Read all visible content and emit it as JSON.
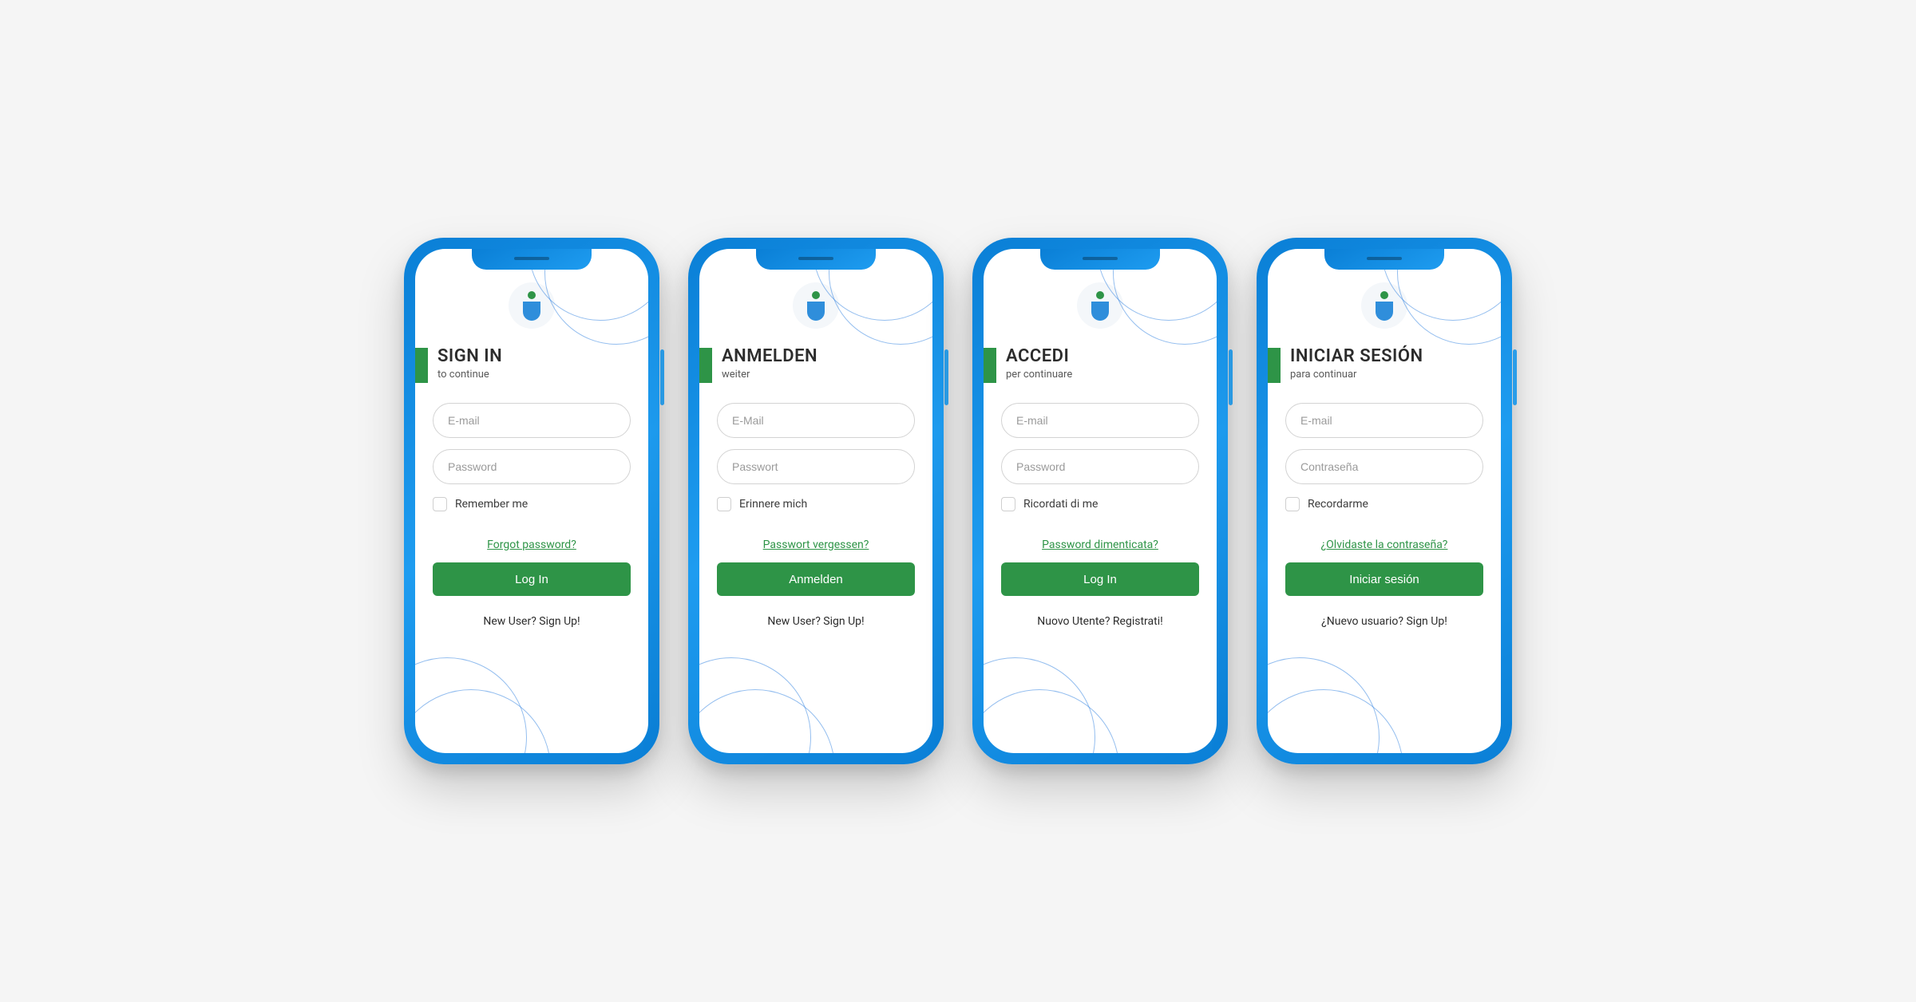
{
  "colors": {
    "accent_green": "#2e9447",
    "phone_blue_start": "#0a7fd6",
    "phone_blue_end": "#1e9cf0",
    "text_dark": "#2c2c2c",
    "text_muted": "#5a5a5a"
  },
  "phones": [
    {
      "title": "SIGN IN",
      "subtitle": "to continue",
      "email_placeholder": "E-mail",
      "password_placeholder": "Password",
      "remember_label": "Remember me",
      "forgot_label": "Forgot password?",
      "login_label": "Log In",
      "signup_label": "New User? Sign Up!"
    },
    {
      "title": "ANMELDEN",
      "subtitle": "weiter",
      "email_placeholder": "E-Mail",
      "password_placeholder": "Passwort",
      "remember_label": "Erinnere mich",
      "forgot_label": "Passwort vergessen?",
      "login_label": "Anmelden",
      "signup_label": "New User? Sign Up!"
    },
    {
      "title": "ACCEDI",
      "subtitle": "per continuare",
      "email_placeholder": "E-mail",
      "password_placeholder": "Password",
      "remember_label": "Ricordati di me",
      "forgot_label": "Password dimenticata?",
      "login_label": "Log In",
      "signup_label": "Nuovo Utente? Registrati!"
    },
    {
      "title": "INICIAR SESIÓN",
      "subtitle": "para continuar",
      "email_placeholder": "E-mail",
      "password_placeholder": "Contraseña",
      "remember_label": "Recordarme",
      "forgot_label": "¿Olvidaste la contraseña?",
      "login_label": "Iniciar sesión",
      "signup_label": "¿Nuevo usuario? Sign Up!"
    }
  ]
}
